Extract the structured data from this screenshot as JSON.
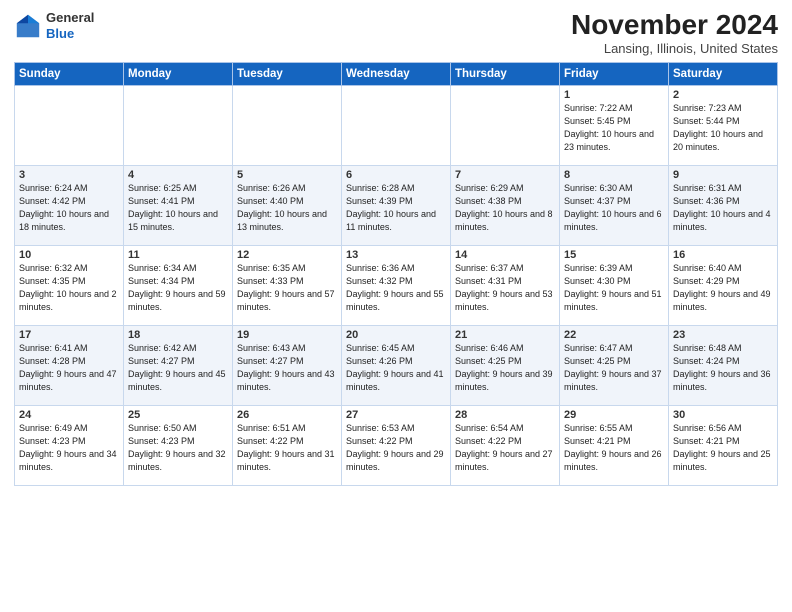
{
  "logo": {
    "general": "General",
    "blue": "Blue"
  },
  "header": {
    "month": "November 2024",
    "location": "Lansing, Illinois, United States"
  },
  "weekdays": [
    "Sunday",
    "Monday",
    "Tuesday",
    "Wednesday",
    "Thursday",
    "Friday",
    "Saturday"
  ],
  "weeks": [
    [
      {
        "day": "",
        "info": ""
      },
      {
        "day": "",
        "info": ""
      },
      {
        "day": "",
        "info": ""
      },
      {
        "day": "",
        "info": ""
      },
      {
        "day": "",
        "info": ""
      },
      {
        "day": "1",
        "info": "Sunrise: 7:22 AM\nSunset: 5:45 PM\nDaylight: 10 hours and 23 minutes."
      },
      {
        "day": "2",
        "info": "Sunrise: 7:23 AM\nSunset: 5:44 PM\nDaylight: 10 hours and 20 minutes."
      }
    ],
    [
      {
        "day": "3",
        "info": "Sunrise: 6:24 AM\nSunset: 4:42 PM\nDaylight: 10 hours and 18 minutes."
      },
      {
        "day": "4",
        "info": "Sunrise: 6:25 AM\nSunset: 4:41 PM\nDaylight: 10 hours and 15 minutes."
      },
      {
        "day": "5",
        "info": "Sunrise: 6:26 AM\nSunset: 4:40 PM\nDaylight: 10 hours and 13 minutes."
      },
      {
        "day": "6",
        "info": "Sunrise: 6:28 AM\nSunset: 4:39 PM\nDaylight: 10 hours and 11 minutes."
      },
      {
        "day": "7",
        "info": "Sunrise: 6:29 AM\nSunset: 4:38 PM\nDaylight: 10 hours and 8 minutes."
      },
      {
        "day": "8",
        "info": "Sunrise: 6:30 AM\nSunset: 4:37 PM\nDaylight: 10 hours and 6 minutes."
      },
      {
        "day": "9",
        "info": "Sunrise: 6:31 AM\nSunset: 4:36 PM\nDaylight: 10 hours and 4 minutes."
      }
    ],
    [
      {
        "day": "10",
        "info": "Sunrise: 6:32 AM\nSunset: 4:35 PM\nDaylight: 10 hours and 2 minutes."
      },
      {
        "day": "11",
        "info": "Sunrise: 6:34 AM\nSunset: 4:34 PM\nDaylight: 9 hours and 59 minutes."
      },
      {
        "day": "12",
        "info": "Sunrise: 6:35 AM\nSunset: 4:33 PM\nDaylight: 9 hours and 57 minutes."
      },
      {
        "day": "13",
        "info": "Sunrise: 6:36 AM\nSunset: 4:32 PM\nDaylight: 9 hours and 55 minutes."
      },
      {
        "day": "14",
        "info": "Sunrise: 6:37 AM\nSunset: 4:31 PM\nDaylight: 9 hours and 53 minutes."
      },
      {
        "day": "15",
        "info": "Sunrise: 6:39 AM\nSunset: 4:30 PM\nDaylight: 9 hours and 51 minutes."
      },
      {
        "day": "16",
        "info": "Sunrise: 6:40 AM\nSunset: 4:29 PM\nDaylight: 9 hours and 49 minutes."
      }
    ],
    [
      {
        "day": "17",
        "info": "Sunrise: 6:41 AM\nSunset: 4:28 PM\nDaylight: 9 hours and 47 minutes."
      },
      {
        "day": "18",
        "info": "Sunrise: 6:42 AM\nSunset: 4:27 PM\nDaylight: 9 hours and 45 minutes."
      },
      {
        "day": "19",
        "info": "Sunrise: 6:43 AM\nSunset: 4:27 PM\nDaylight: 9 hours and 43 minutes."
      },
      {
        "day": "20",
        "info": "Sunrise: 6:45 AM\nSunset: 4:26 PM\nDaylight: 9 hours and 41 minutes."
      },
      {
        "day": "21",
        "info": "Sunrise: 6:46 AM\nSunset: 4:25 PM\nDaylight: 9 hours and 39 minutes."
      },
      {
        "day": "22",
        "info": "Sunrise: 6:47 AM\nSunset: 4:25 PM\nDaylight: 9 hours and 37 minutes."
      },
      {
        "day": "23",
        "info": "Sunrise: 6:48 AM\nSunset: 4:24 PM\nDaylight: 9 hours and 36 minutes."
      }
    ],
    [
      {
        "day": "24",
        "info": "Sunrise: 6:49 AM\nSunset: 4:23 PM\nDaylight: 9 hours and 34 minutes."
      },
      {
        "day": "25",
        "info": "Sunrise: 6:50 AM\nSunset: 4:23 PM\nDaylight: 9 hours and 32 minutes."
      },
      {
        "day": "26",
        "info": "Sunrise: 6:51 AM\nSunset: 4:22 PM\nDaylight: 9 hours and 31 minutes."
      },
      {
        "day": "27",
        "info": "Sunrise: 6:53 AM\nSunset: 4:22 PM\nDaylight: 9 hours and 29 minutes."
      },
      {
        "day": "28",
        "info": "Sunrise: 6:54 AM\nSunset: 4:22 PM\nDaylight: 9 hours and 27 minutes."
      },
      {
        "day": "29",
        "info": "Sunrise: 6:55 AM\nSunset: 4:21 PM\nDaylight: 9 hours and 26 minutes."
      },
      {
        "day": "30",
        "info": "Sunrise: 6:56 AM\nSunset: 4:21 PM\nDaylight: 9 hours and 25 minutes."
      }
    ]
  ]
}
